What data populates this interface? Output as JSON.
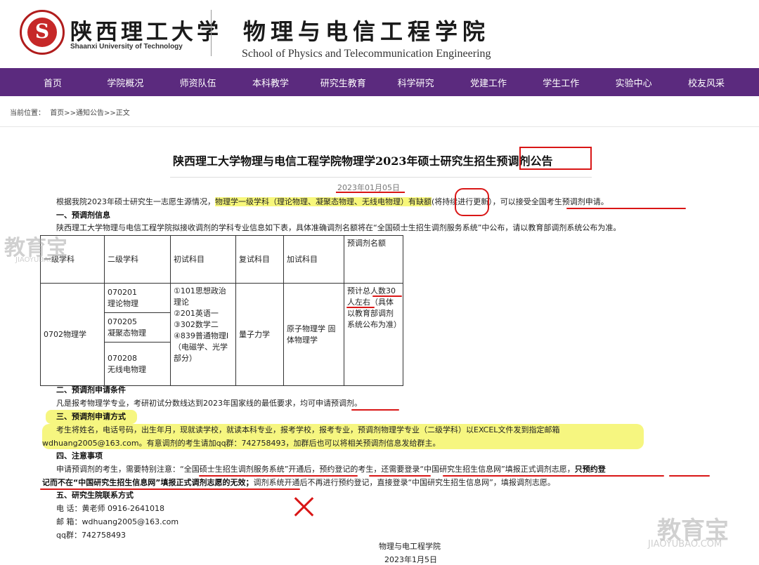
{
  "header": {
    "university_cn": "陕西理工大学",
    "university_en": "Shaanxi University of Technology",
    "school_cn": "物理与电信工程学院",
    "school_en": "School of Physics and Telecommunication Engineering"
  },
  "nav": {
    "items": [
      "首页",
      "学院概况",
      "师资队伍",
      "本科教学",
      "研究生教育",
      "科学研究",
      "党建工作",
      "学生工作",
      "实验中心",
      "校友风采"
    ]
  },
  "breadcrumb": {
    "prefix": "当前位置：",
    "path": "首页>>通知公告>>正文"
  },
  "article": {
    "title": "陕西理工大学物理与电信工程学院物理学2023年硕士研究生招生预调剂公告",
    "date": "2023年01月05日",
    "intro_a": "根据我院2023年硕士研究生一志愿生源情况，",
    "intro_hl": "物理学一级学科（理论物理、凝聚态物理、无线电物理）",
    "intro_quota": "有缺额",
    "intro_b": "(将持续进行更新），",
    "intro_c": "可以接受全国考生预调剂申请。",
    "s1_title": "一、预调剂信息",
    "s1_text": "陕西理工大学物理与电信工程学院拟接收调剂的学科专业信息如下表，具体准确调剂名额将在“全国硕士生招生调剂服务系统”中公布，请以教育部调剂系统公布为准。",
    "table": {
      "headers": [
        "一级学科",
        "二级学科",
        "初试科目",
        "复试科目",
        "加试科目",
        "预调剂名额"
      ],
      "first_level": "0702物理学",
      "second_level": [
        {
          "code": "070201",
          "name": "理论物理"
        },
        {
          "code": "070205",
          "name": "凝聚态物理"
        },
        {
          "code": "070208",
          "name": "无线电物理"
        }
      ],
      "exam_subjects": [
        "①101思想政治理论",
        "②201英语一",
        "③302数学二",
        "④839普通物理Ⅰ（电磁学、光学部分）"
      ],
      "retest": "量子力学",
      "extra": "原子物理学 固体物理学",
      "quota": "预计总人数30人左右（具体以教育部调剂系统公布为准）"
    },
    "s2_title": "二、预调剂申请条件",
    "s2_text_a": "凡是报考物理学专业，考研初试分数线达到2023年国家线的最低要求，均可",
    "s2_text_b": "申请预调剂",
    "s2_text_c": "。",
    "s3_title": "三、预调剂申请方式",
    "s3_line1": "考生将姓名，电话号码，出生年月，现就读学校，就读本科专业，报考学校，报考专业，预调剂物理学专业（二级学科）以EXCEL文件发到指定邮箱",
    "s3_line2": "wdhuang2005@163.com。有意调剂的考生请加qq群：742758493，加群后也可以将相关预调剂信息发给群主。",
    "s4_title": "四、注意事项",
    "s4_line1": "申请预调剂的考生，需要特别注意：“全国硕士生招生调剂服务系统”开通后，预约登记的考生，还需要登录“中国研究生招生信息网”填报正式调剂志愿，",
    "s4_line1_bold": "只预约登",
    "s4_line2_bold": "记而不在“中国研究生招生信息网”填报正式调剂志愿的无效；",
    "s4_line2": "调剂系统开通后不再进行预约登记，直接登录“中国研究生招生信息网”，填报调剂志愿。",
    "s5_title": "五、研究生院联系方式",
    "phone": "电  话：黄老师 0916-2641018",
    "email": "邮  箱：wdhuang2005@163.com",
    "qq": "qq群：742758493",
    "signature_org": "物理与电工程学院",
    "signature_date": "2023年1月5日"
  },
  "watermark": {
    "brand": "教育宝",
    "url": "JIAOYUBAO.CN",
    "url_alt": "JIAOYUBAO.COM"
  },
  "colors": {
    "nav_bg": "#5b2a7e",
    "highlight": "#f5f56a",
    "annotation_red": "#d91616"
  }
}
